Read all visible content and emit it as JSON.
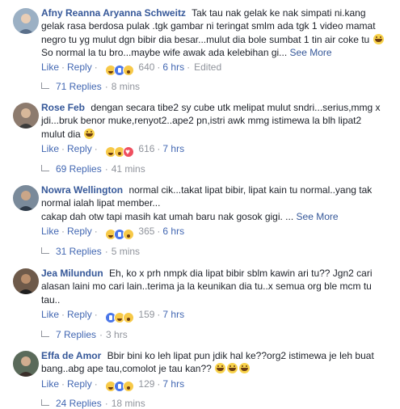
{
  "labels": {
    "like": "Like",
    "reply": "Reply",
    "see_more": "See More",
    "edited": "Edited",
    "sep": "·"
  },
  "comments": [
    {
      "author": "Afny Reanna Aryanna Schweitz",
      "text": "Tak tau nak gelak ke nak simpati ni.kang gelak rasa berdosa pulak .tgk gambar ni teringat smlm ada tgk 1 video mamat negro tu yg mulut dgn bibir dia besar...mulut dia bole sumbat 1 tin air coke tu",
      "text2": "So normal la tu bro...maybe wife awak ada kelebihan gi...",
      "reaction_count": "640",
      "time": "6 hrs",
      "replies": "71 Replies",
      "replies_time": "8 mins",
      "reactions": [
        "haha",
        "like",
        "wow"
      ],
      "avatar_color": "#9bb0c4"
    },
    {
      "author": "Rose Feb",
      "text": "dengan secara tibe2 sy cube utk melipat mulut sndri...serius,mmg x jdi...bruk benor muke,renyot2..ape2 pn,istri awk mmg istimewa la blh lipat2 mulut dia",
      "reaction_count": "616",
      "time": "7 hrs",
      "replies": "69 Replies",
      "replies_time": "41 mins",
      "reactions": [
        "haha",
        "wow",
        "love"
      ],
      "avatar_color": "#8d7b6e"
    },
    {
      "author": "Nowra Wellington",
      "text": "normal cik...takat lipat bibir, lipat kain tu normal..yang tak normal ialah lipat member...",
      "text2": "cakap dah otw tapi masih kat umah baru nak gosok gigi. ...",
      "reaction_count": "365",
      "time": "6 hrs",
      "replies": "31 Replies",
      "replies_time": "5 mins",
      "reactions": [
        "haha",
        "like",
        "wow"
      ],
      "avatar_color": "#7a8a9a"
    },
    {
      "author": "Jea Milundun",
      "text": "Eh, ko x prh nmpk dia lipat bibir sblm kawin ari tu?? Jgn2 cari alasan laini mo cari lain..terima ja la keunikan dia tu..x semua org ble mcm tu tau..",
      "reaction_count": "159",
      "time": "7 hrs",
      "replies": "7 Replies",
      "replies_time": "3 hrs",
      "reactions": [
        "like",
        "haha",
        "wow"
      ],
      "avatar_color": "#6e5a4a"
    },
    {
      "author": "Effa de Amor",
      "text": "Bbir bini ko leh lipat pun jdik hal ke??org2 istimewa je leh buat bang..abg ape tau,comolot je tau kan??",
      "reaction_count": "129",
      "time": "7 hrs",
      "replies": "24 Replies",
      "replies_time": "18 mins",
      "reactions": [
        "haha",
        "like",
        "wow"
      ],
      "avatar_color": "#5a6a5a"
    }
  ]
}
